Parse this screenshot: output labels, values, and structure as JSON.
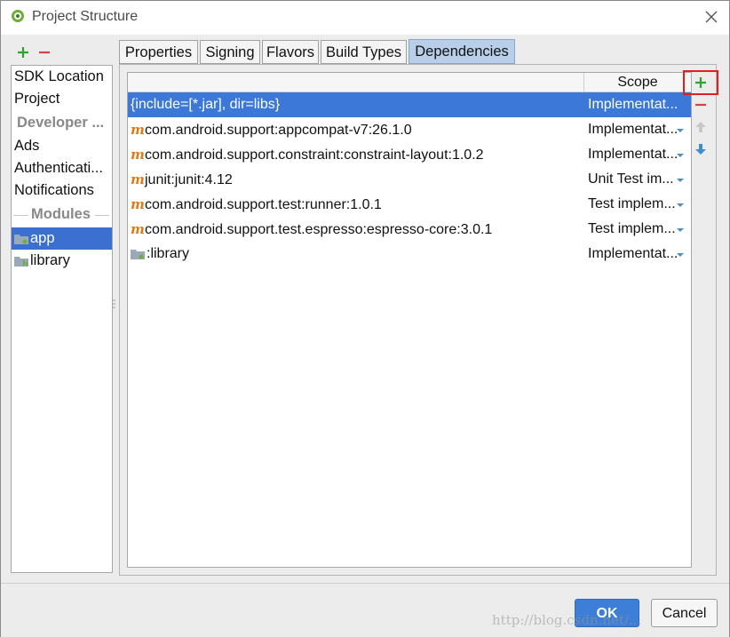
{
  "window": {
    "title": "Project Structure"
  },
  "left_toolbar": {
    "add_icon": "plus-icon",
    "remove_icon": "minus-icon"
  },
  "sidebar": {
    "items": [
      {
        "label": "SDK Location",
        "type": "item"
      },
      {
        "label": "Project",
        "type": "item"
      },
      {
        "label": "Developer ...",
        "type": "header"
      },
      {
        "label": "Ads",
        "type": "item"
      },
      {
        "label": "Authenticati...",
        "type": "item"
      },
      {
        "label": "Notifications",
        "type": "item"
      },
      {
        "label": "Modules",
        "type": "header"
      },
      {
        "label": "app",
        "type": "module",
        "selected": true
      },
      {
        "label": "library",
        "type": "module"
      }
    ]
  },
  "tabs": [
    {
      "label": "Properties"
    },
    {
      "label": "Signing"
    },
    {
      "label": "Flavors"
    },
    {
      "label": "Build Types"
    },
    {
      "label": "Dependencies",
      "active": true
    }
  ],
  "table": {
    "header": {
      "scope": "Scope"
    },
    "rows": [
      {
        "name": "{include=[*.jar], dir=libs}",
        "scope": "Implementat...",
        "icon": "none",
        "selected": true
      },
      {
        "name": "com.android.support:appcompat-v7:26.1.0",
        "scope": "Implementat...",
        "icon": "maven-icon"
      },
      {
        "name": "com.android.support.constraint:constraint-layout:1.0.2",
        "scope": "Implementat...",
        "icon": "maven-icon"
      },
      {
        "name": "junit:junit:4.12",
        "scope": "Unit Test im...",
        "icon": "maven-icon"
      },
      {
        "name": "com.android.support.test:runner:1.0.1",
        "scope": "Test implem...",
        "icon": "maven-icon"
      },
      {
        "name": "com.android.support.test.espresso:espresso-core:3.0.1",
        "scope": "Test implem...",
        "icon": "maven-icon"
      },
      {
        "name": ":library",
        "scope": "Implementat...",
        "icon": "module-folder-icon"
      }
    ],
    "maven_glyph": "m"
  },
  "side_toolbar": {
    "add_icon": "plus-icon",
    "remove_icon": "minus-icon",
    "up_icon": "arrow-up-icon",
    "down_icon": "arrow-down-icon"
  },
  "buttons": {
    "ok": "OK",
    "cancel": "Cancel"
  },
  "watermark": "http://blog.csdn.net/...",
  "colors": {
    "selection": "#3b78d8",
    "tab_active": "#b9cfe9",
    "add_green": "#2fa32f",
    "remove_red": "#d94040",
    "highlight_box": "#e02020",
    "ok_button": "#3d7fd6"
  }
}
